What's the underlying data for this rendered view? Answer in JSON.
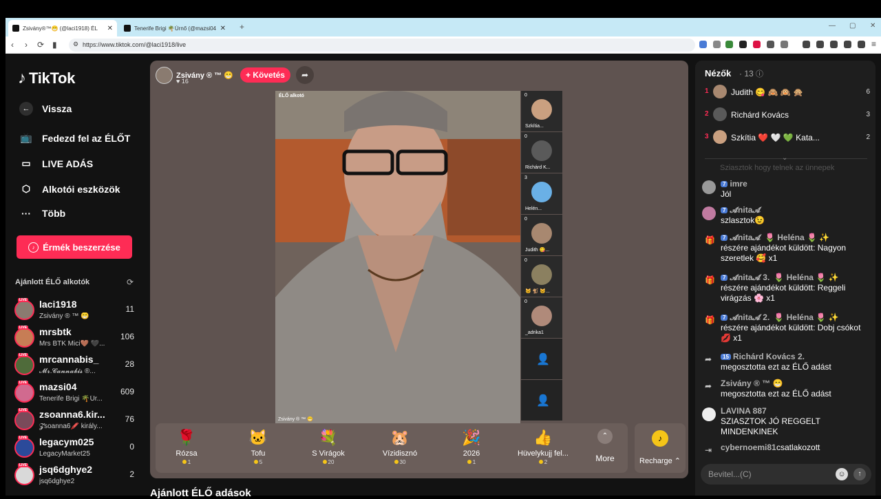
{
  "browser": {
    "tabs": [
      {
        "title": "Zsivány®™😁 (@laci1918) ÉL"
      },
      {
        "title": "Tenerife Brigi 🌴Úrnő (@mazsi04) É..."
      }
    ],
    "url": "https://www.tiktok.com/@laci1918/live"
  },
  "sidebar": {
    "logo": "TikTok",
    "back": "Vissza",
    "nav": [
      "Fedezd fel az ÉLŐT",
      "LIVE ADÁS",
      "Alkotói eszközök",
      "Több"
    ],
    "coins_button": "Érmék beszerzése",
    "recommended_title": "Ajánlott ÉLŐ alkotók",
    "live_badge": "LIVE",
    "creators": [
      {
        "name": "laci1918",
        "sub": "Zsivány ® ™ 😁",
        "count": "11",
        "color": "#8a7b70"
      },
      {
        "name": "mrsbtk",
        "sub": "Mrs BTK Mici🤎 🖤...",
        "count": "106",
        "color": "#c77d55"
      },
      {
        "name": "mrcannabis_",
        "sub": "𝓜𝓻.𝓒𝓪𝓷𝓷𝓪𝓫𝓲𝓼 ®...",
        "count": "28",
        "color": "#4f6b3a"
      },
      {
        "name": "mazsi04",
        "sub": "Tenerife Brigi 🌴Úr...",
        "count": "609",
        "color": "#d16a8f"
      },
      {
        "name": "zsoanna6.kir...",
        "sub": "𝓩soanna6🖍️ király...",
        "count": "76",
        "color": "#7a4a5a"
      },
      {
        "name": "legacym025",
        "sub": "LegacyMarket25",
        "count": "0",
        "color": "#2b4a9a"
      },
      {
        "name": "jsq6dghye2",
        "sub": "jsq6dghye2",
        "count": "2",
        "color": "#d9d9d9"
      }
    ]
  },
  "stage": {
    "host_name": "Zsivány ® ™ 😁",
    "host_likes": "♥ 16",
    "follow": "+ Követés",
    "video_label": "ÉLŐ alkotó",
    "video_caption": "Zsivány ® ™ 😁",
    "guests": [
      {
        "count": "0",
        "name": "Szkítia...",
        "color": "#caa080"
      },
      {
        "count": "0",
        "name": "Richárd K...",
        "color": "#5a5a5a"
      },
      {
        "count": "3",
        "name": "Helén...",
        "color": "#6ab0e6"
      },
      {
        "count": "0",
        "name": "Judith 😋...",
        "color": "#a88870"
      },
      {
        "count": "0",
        "name": "🐱 🐒 🐱...",
        "color": "#8b8060"
      },
      {
        "count": "0",
        "name": "_adrika1",
        "color": "#b08a7a"
      }
    ],
    "gifts": [
      {
        "icon": "🌹",
        "name": "Rózsa",
        "price": "1"
      },
      {
        "icon": "🐱",
        "name": "Tofu",
        "price": "5"
      },
      {
        "icon": "💐",
        "name": "S Virágok",
        "price": "20"
      },
      {
        "icon": "🐹",
        "name": "Vízidisznó",
        "price": "30"
      },
      {
        "icon": "🎉",
        "name": "2026",
        "price": "1"
      },
      {
        "icon": "👍",
        "name": "Hüvelykujj fel...",
        "price": "2"
      }
    ],
    "more": "More",
    "recharge": "Recharge ⌃",
    "below_title": "Ajánlott ÉLŐ adások"
  },
  "chat": {
    "viewers_title": "Nézők",
    "viewers_count": "· 13",
    "top_viewers": [
      {
        "rank": "1",
        "name": "Judith 😋 🙈 🙉 🙊",
        "score": "6",
        "color": "#a88870"
      },
      {
        "rank": "2",
        "name": "Richárd Kovács",
        "score": "3",
        "color": "#5a5a5a"
      },
      {
        "rank": "3",
        "name": "Szkítia ❤️ 🤍 💚 Kata...",
        "score": "2",
        "color": "#caa080"
      }
    ],
    "faded_line": "Sziasztok hogy telnek az ünnepek",
    "messages": [
      {
        "kind": "avatar",
        "color": "#999",
        "level": "7",
        "user": "imre",
        "extra": "",
        "body": "Jól"
      },
      {
        "kind": "avatar",
        "color": "#c07aa0",
        "level": "7",
        "user": "𝓐nita𝓐",
        "extra": "",
        "body": "szlasztok😉"
      },
      {
        "kind": "gift",
        "level": "7",
        "user": "𝓐nita𝓐",
        "extra": "🌷 Heléna 🌷 ✨",
        "body": "részére ajándékot küldött: Nagyon szeretlek 🥰 x1"
      },
      {
        "kind": "gift",
        "level": "7",
        "user": "𝓐nita𝓐 3.",
        "extra": "🌷 Heléna 🌷 ✨",
        "body": "részére ajándékot küldött: Reggeli virágzás 🌸 x1"
      },
      {
        "kind": "gift",
        "level": "7",
        "user": "𝓐nita𝓐 2.",
        "extra": "🌷 Heléna 🌷 ✨",
        "body": "részére ajándékot küldött: Dobj csókot 💋 x1"
      },
      {
        "kind": "share",
        "level": "15",
        "user": "Richárd Kovács 2.",
        "extra": "",
        "body": "megosztotta ezt az ÉLŐ adást"
      },
      {
        "kind": "share",
        "level": "",
        "user": "Zsivány ® ™ 😁",
        "extra": "",
        "body": "megosztotta ezt az ÉLŐ adást"
      },
      {
        "kind": "avatar",
        "color": "#eee",
        "level": "",
        "user": "LAVINA 887",
        "extra": "",
        "body": "SZIASZTOK JÓ REGGELT MINDENKINEK"
      },
      {
        "kind": "join",
        "level": "",
        "user": "cybernoemi81",
        "extra": "",
        "body": "csatlakozott"
      }
    ],
    "input_placeholder": "Bevitel...(C)"
  }
}
